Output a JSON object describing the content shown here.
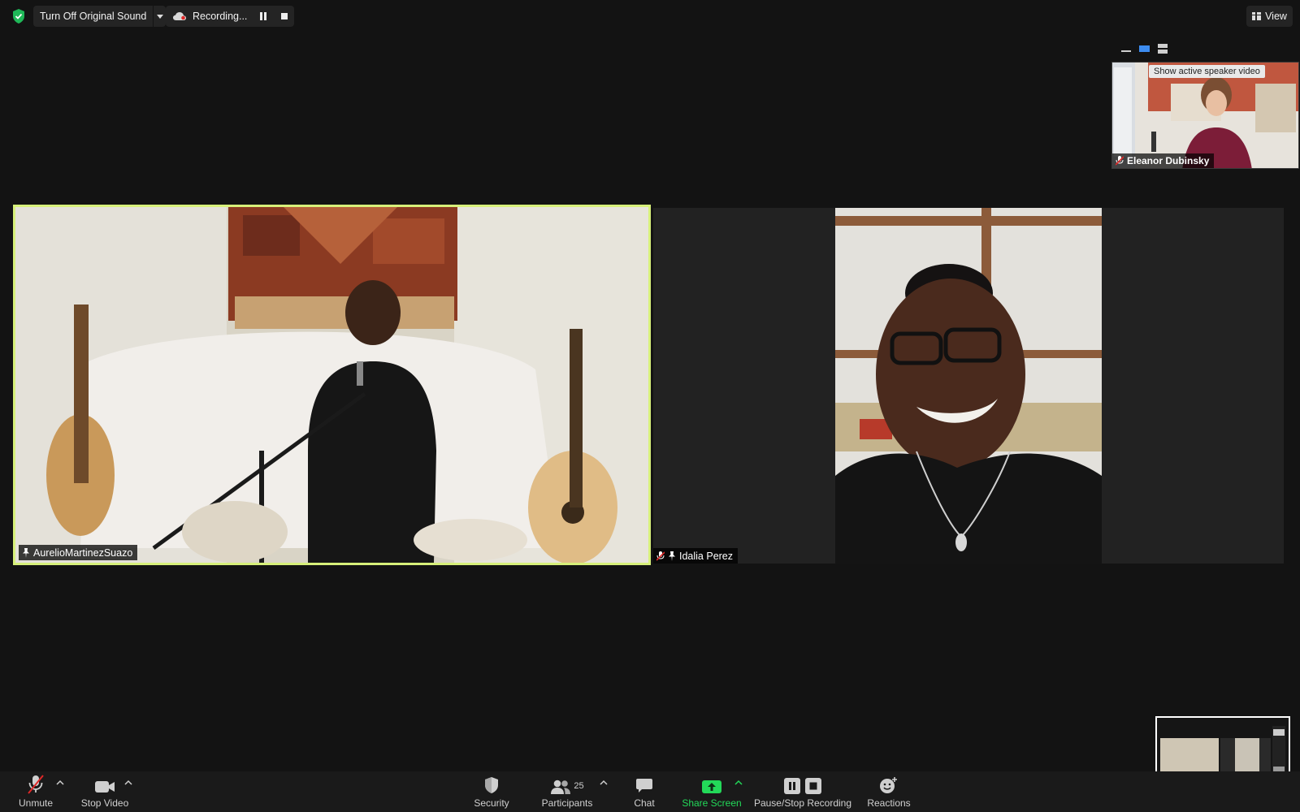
{
  "topbar": {
    "original_sound_label": "Turn Off Original Sound",
    "recording_label": "Recording...",
    "view_label": "View"
  },
  "active_speaker": {
    "tooltip": "Show active speaker video",
    "name": "Eleanor Dubinsky"
  },
  "tiles": [
    {
      "name": "AurelioMartinezSuazo",
      "muted": false,
      "pinned": true,
      "active": true
    },
    {
      "name": "Idalia Perez",
      "muted": true,
      "pinned": true,
      "active": false
    }
  ],
  "toolbar": {
    "unmute": "Unmute",
    "stop_video": "Stop Video",
    "security": "Security",
    "participants": "Participants",
    "participants_count": "25",
    "chat": "Chat",
    "share_screen": "Share Screen",
    "pause_stop_recording": "Pause/Stop Recording",
    "reactions": "Reactions"
  },
  "colors": {
    "background": "#131313",
    "toolbar": "#1a1a1a",
    "active_border": "#d7f07a",
    "share_green": "#23d959",
    "muted_red": "#e02828"
  },
  "icons": {
    "security_status": "shield-check-icon",
    "recording": "cloud-icon",
    "view": "grid-icon"
  }
}
